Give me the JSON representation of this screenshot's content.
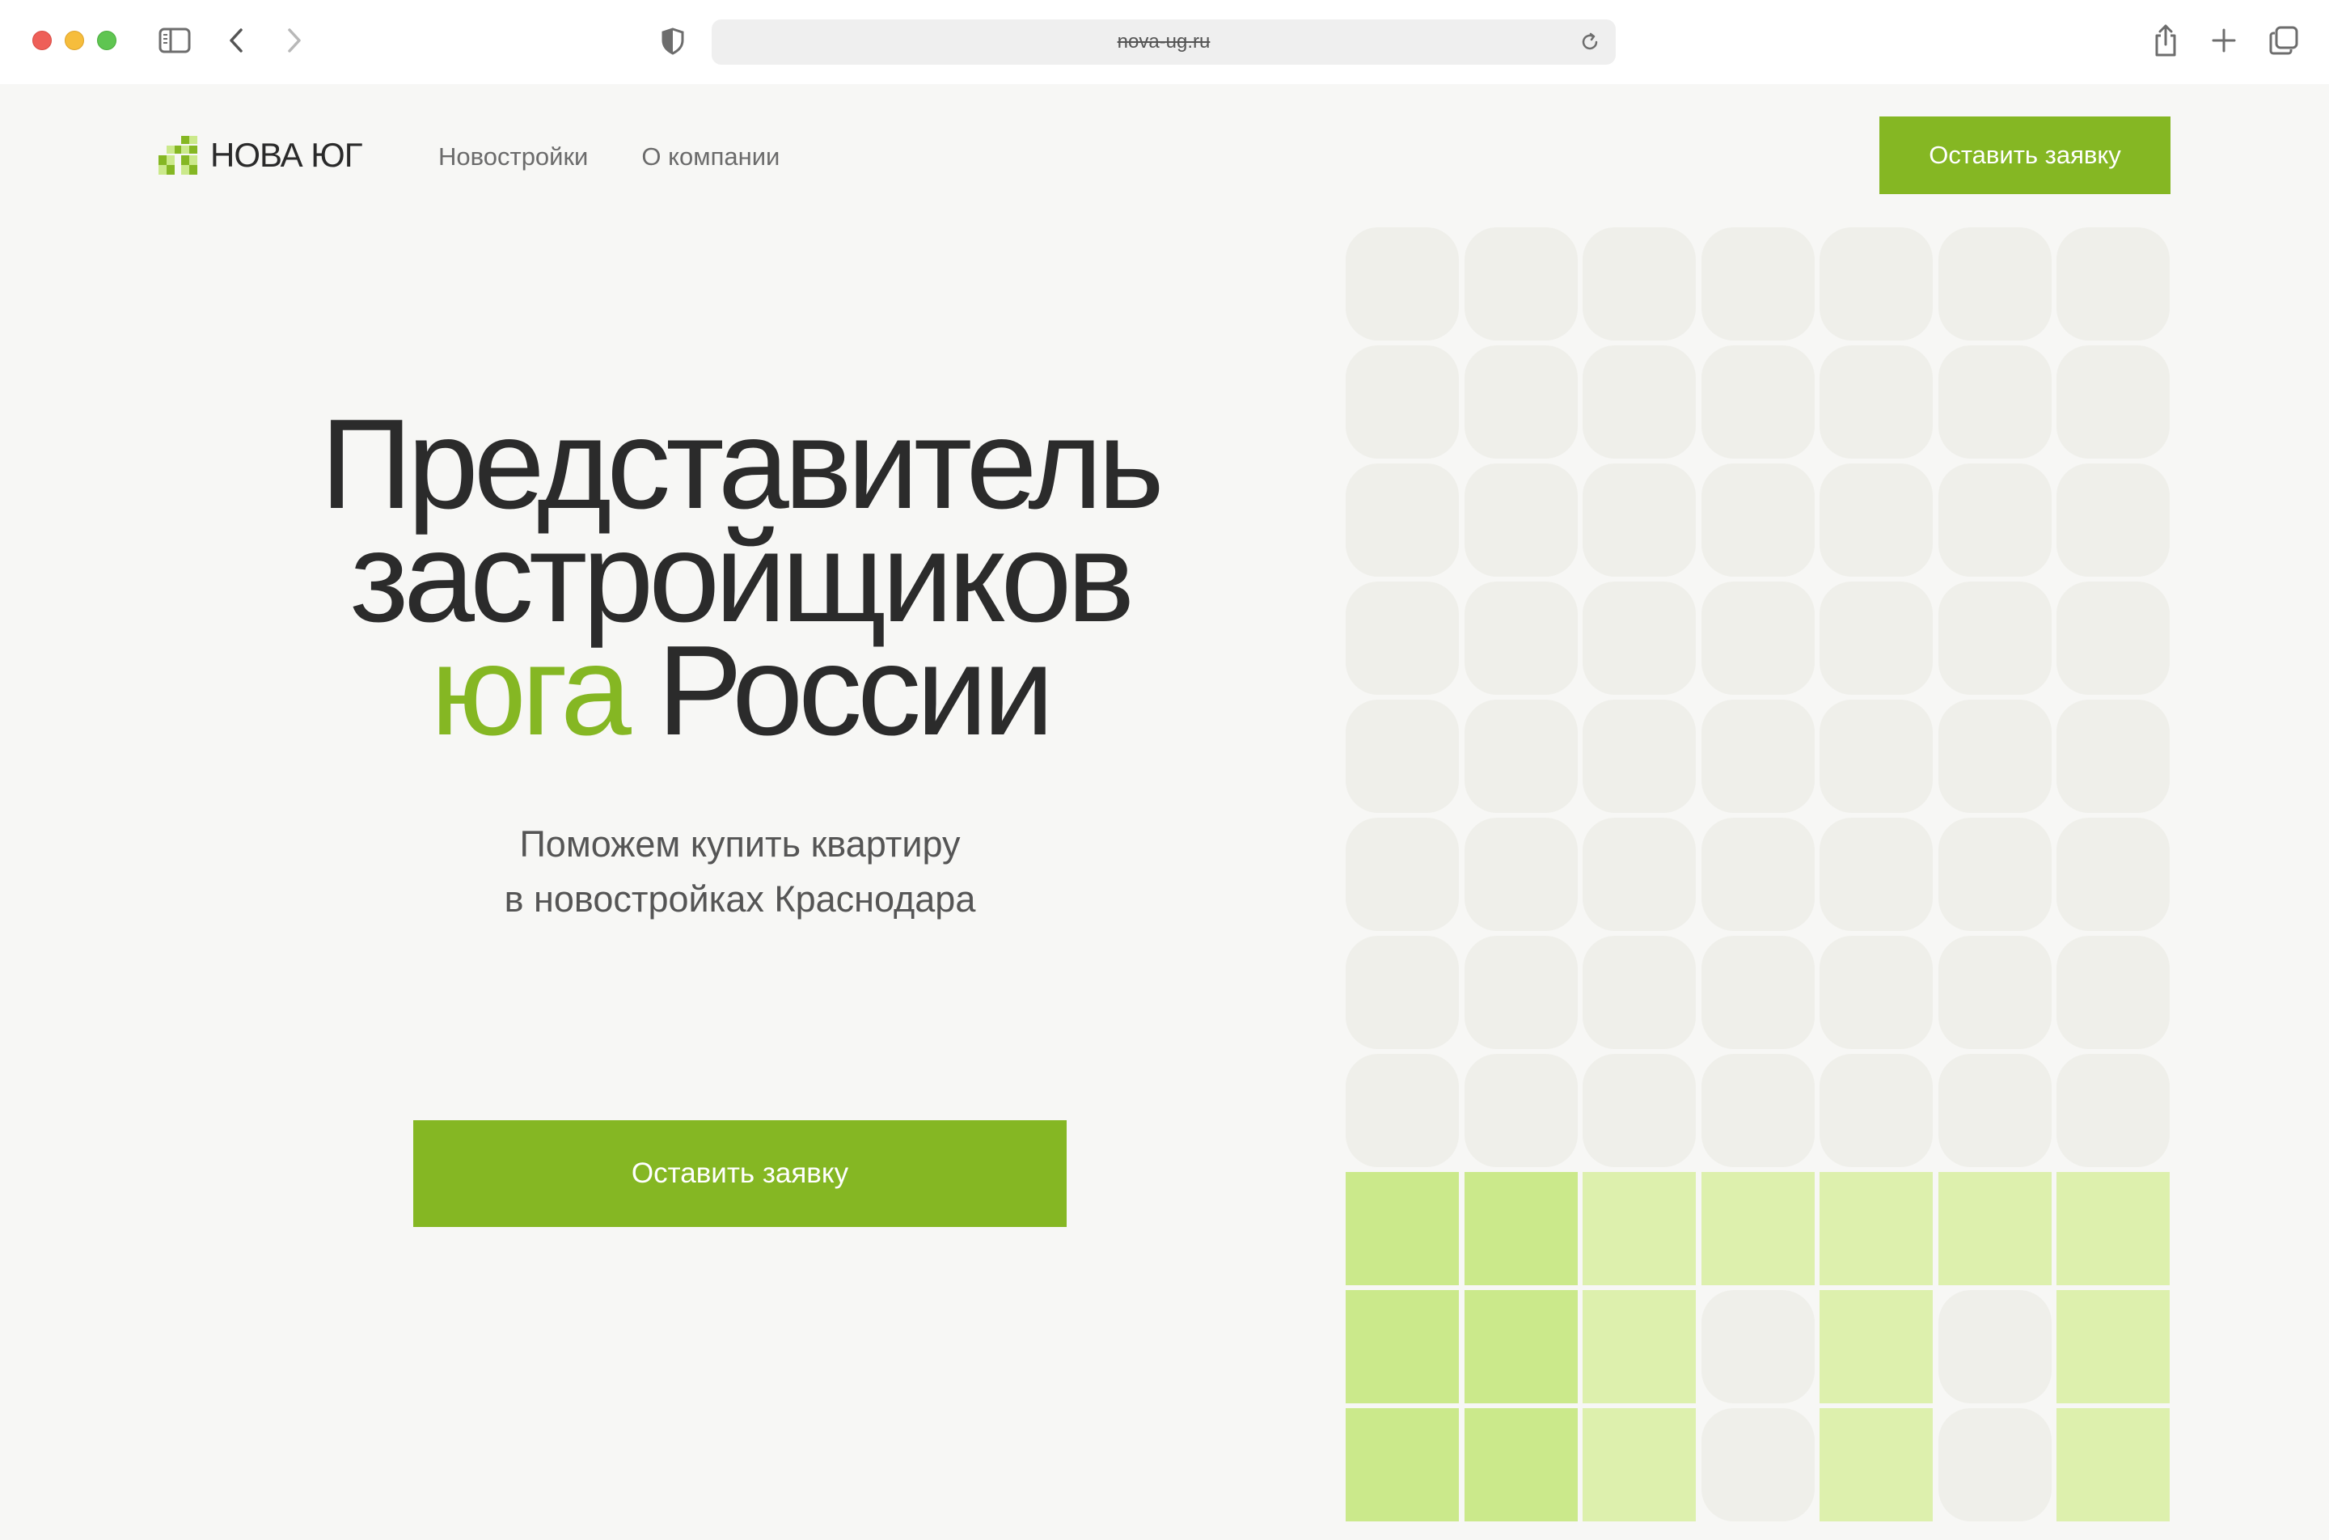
{
  "browser": {
    "url": "nova-ug.ru"
  },
  "header": {
    "logo_text": "НОВА ЮГ",
    "nav": [
      {
        "label": "Новостройки"
      },
      {
        "label": "О компании"
      }
    ],
    "cta_label": "Оставить заявку"
  },
  "hero": {
    "line1": "Представитель",
    "line2": "застройщиков",
    "accent_word": "юга",
    "line3_rest": "России",
    "subtitle_line1": "Поможем купить квартиру",
    "subtitle_line2": "в новостройках Краснодара",
    "cta_label": "Оставить заявку"
  },
  "colors": {
    "accent": "#85b723",
    "text": "#2b2b2b",
    "background": "#f7f7f5",
    "tile_empty": "#efefea",
    "tile_green_strong": "#cbe98b",
    "tile_green_light": "#ddf0ad"
  },
  "mosaic": {
    "columns": 7,
    "rows": [
      "eeeeeee",
      "eeeeeee",
      "eeeeeee",
      "eeeeeee",
      "eeeeeee",
      "eeeeeee",
      "eeeeeee",
      "eeeeeee",
      "ggllllll",
      "gglelel",
      "gglelel"
    ]
  }
}
